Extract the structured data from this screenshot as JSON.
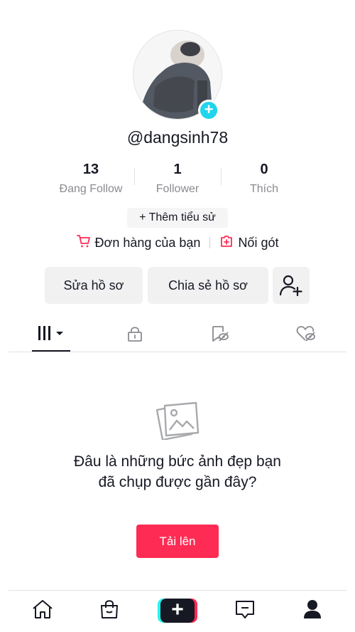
{
  "profile": {
    "username": "@dangsinh78",
    "stats": [
      {
        "value": "13",
        "label": "Đang Follow"
      },
      {
        "value": "1",
        "label": "Follower"
      },
      {
        "value": "0",
        "label": "Thích"
      }
    ],
    "add_bio_label": "+ Thêm tiểu sử",
    "orders_label": "Đơn hàng của bạn",
    "connect_label": "Nối gót",
    "edit_profile_label": "Sửa hồ sơ",
    "share_profile_label": "Chia sẻ hồ sơ"
  },
  "tabs": [
    {
      "icon": "videos-grid-icon",
      "active": true
    },
    {
      "icon": "lock-icon",
      "active": false
    },
    {
      "icon": "bookmark-icon",
      "active": false
    },
    {
      "icon": "liked-hidden-icon",
      "active": false
    }
  ],
  "empty_state": {
    "icon": "photos-icon",
    "message": "Đâu là những bức ảnh đẹp bạn đã chụp được gần đây?",
    "upload_label": "Tải lên"
  },
  "bottom_nav": [
    "home-icon",
    "shop-icon",
    "create-icon",
    "inbox-icon",
    "profile-icon"
  ],
  "colors": {
    "accent_red": "#fe2c55",
    "accent_cyan": "#25f4ee",
    "avatar_plus": "#20d5ec",
    "text": "#161823",
    "muted": "#8a8b91"
  }
}
